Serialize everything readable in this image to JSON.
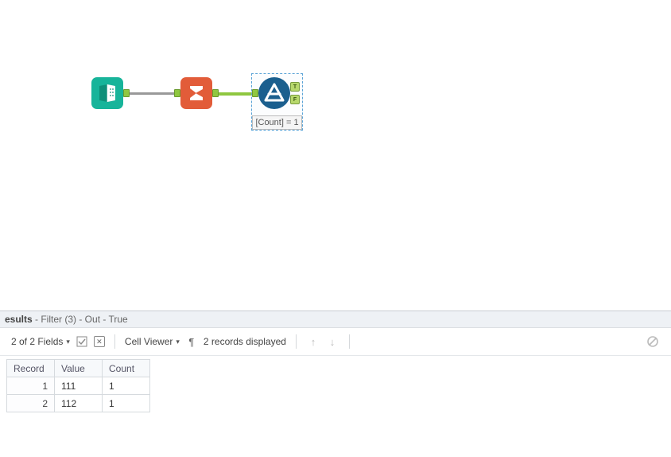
{
  "canvas": {
    "tools": {
      "input_data": {
        "name": "input-data-tool"
      },
      "summarize": {
        "name": "summarize-tool"
      },
      "filter": {
        "name": "filter-tool",
        "caption": "[Count] = 1",
        "tag_true": "T",
        "tag_false": "F"
      }
    }
  },
  "results": {
    "title_bold": "esults",
    "title_rest": " - Filter (3) - Out - True",
    "toolbar": {
      "fields_label": "2 of 2 Fields",
      "cell_viewer_label": "Cell Viewer",
      "records_label": "2 records displayed"
    },
    "columns": {
      "record": "Record",
      "value": "Value",
      "count": "Count"
    },
    "rows": [
      {
        "record": "1",
        "value": "111",
        "count": "1"
      },
      {
        "record": "2",
        "value": "112",
        "count": "1"
      }
    ]
  }
}
